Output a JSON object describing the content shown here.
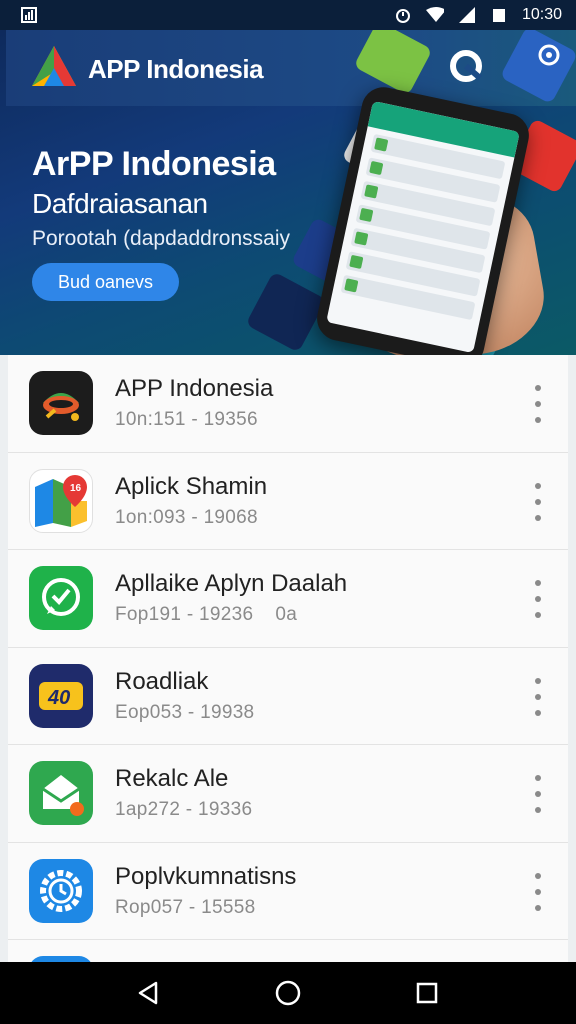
{
  "status_bar": {
    "time": "10:30",
    "icons": [
      "app-notification-icon",
      "alarm-icon",
      "wifi-icon",
      "cell-signal-icon",
      "battery-icon"
    ]
  },
  "hero": {
    "brand_name": "APP Indonesia",
    "title": "ArPP Indonesia",
    "subtitle": "Dafdraiasanan",
    "tagline": "Porootah (dapdaddronssaiy",
    "button_label": "Bud oanevs",
    "colors": {
      "background": "#133a7a",
      "button": "#2f86e8"
    }
  },
  "apps": [
    {
      "name": "APP Indonesia",
      "meta": "10n:151 - 19356",
      "icon": "robot-dish-icon",
      "icon_bg": "#1c1c1c"
    },
    {
      "name": "Aplick Shamin",
      "meta": "1on:093 - 19068",
      "icon": "maps-pin-icon",
      "icon_bg": "#ffffff"
    },
    {
      "name": "Apllaike Aplyn Daalah",
      "meta": "Fop191 - 19236",
      "meta_extra": "0a",
      "icon": "chat-bubble-icon",
      "icon_bg": "#1fb24a"
    },
    {
      "name": "Roadliak",
      "meta": "Eop053 - 19938",
      "icon": "badge-40-icon",
      "icon_bg": "#1f2b6b"
    },
    {
      "name": "Rekalc Ale",
      "meta": "1ap272 - 19336",
      "icon": "envelope-star-icon",
      "icon_bg": "#2fa84f"
    },
    {
      "name": "Poplvkumnatisns",
      "meta": "Rop057 - 15558",
      "icon": "gear-clock-icon",
      "icon_bg": "#1e88e5"
    }
  ],
  "nav_bar": {
    "buttons": [
      "back-icon",
      "home-icon",
      "recents-icon"
    ]
  }
}
